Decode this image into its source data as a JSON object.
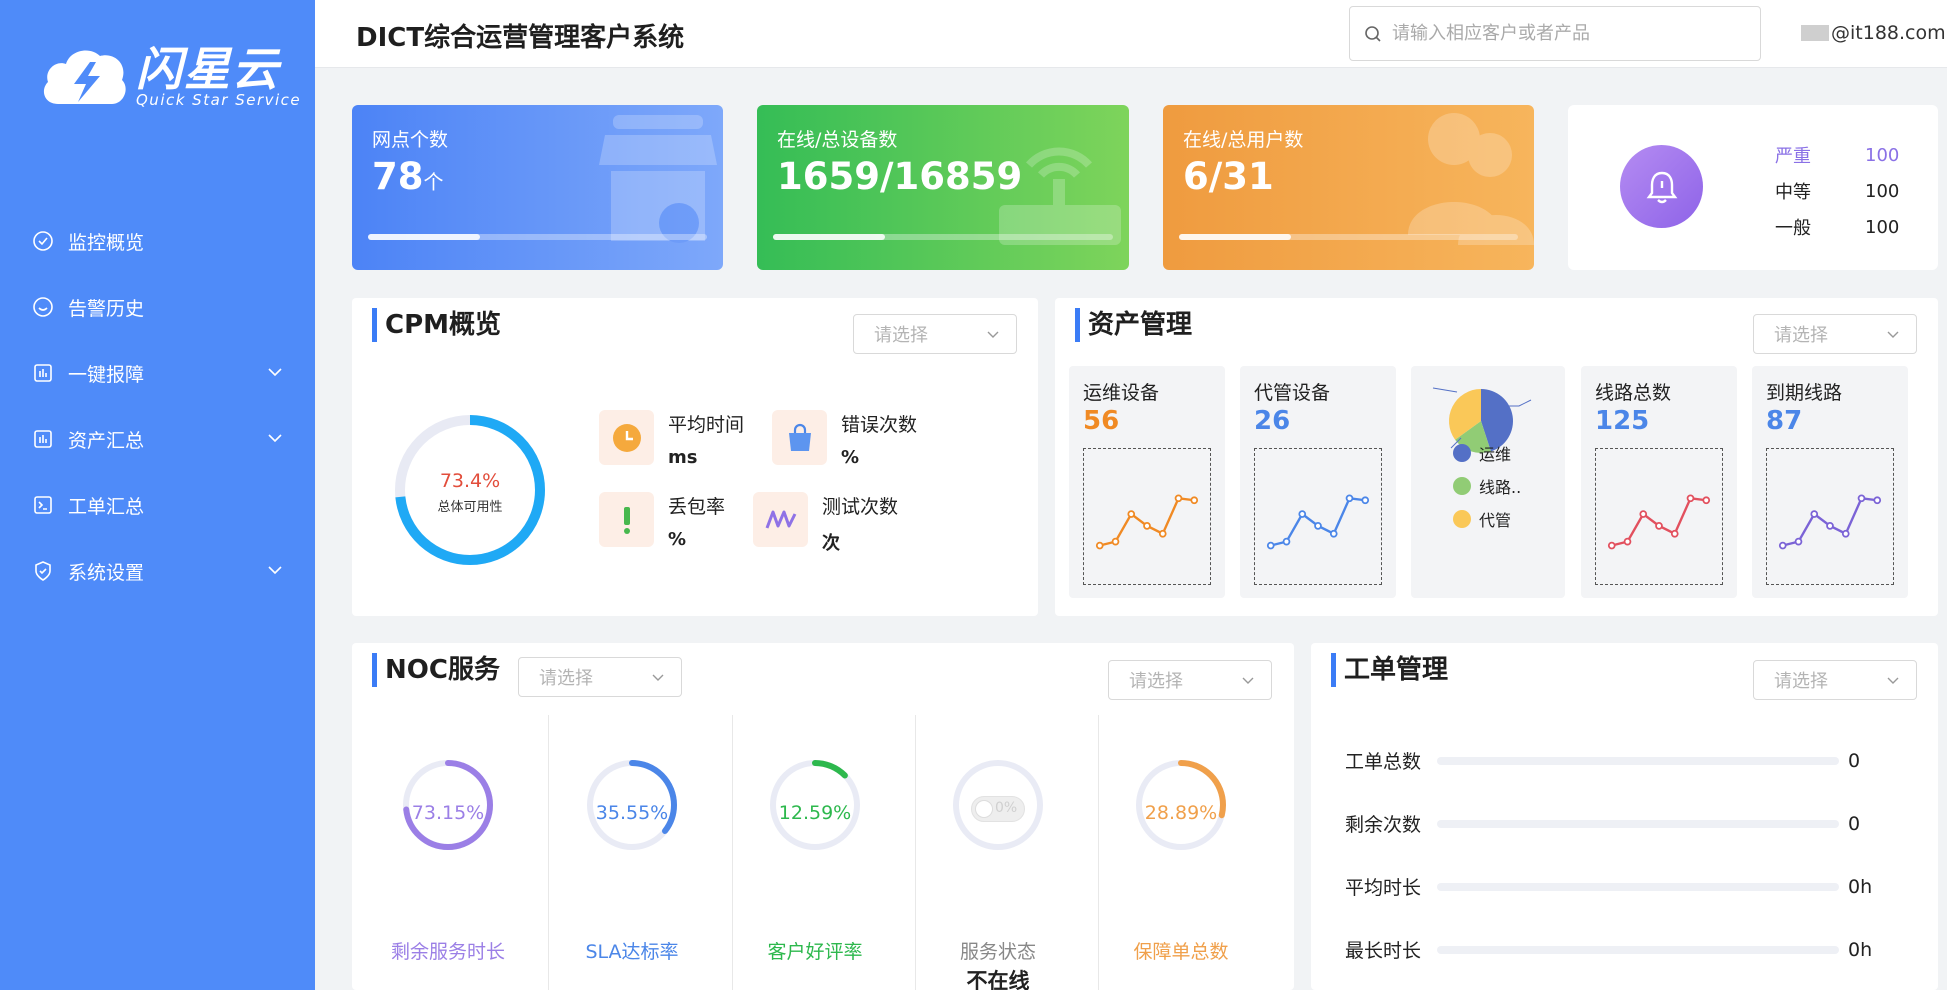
{
  "app": {
    "logo_cn": "闪星云",
    "logo_en": "Quick Star Service",
    "title": "DICT综合运营管理客户系统"
  },
  "header": {
    "search_placeholder": "请输入相应客户或者产品",
    "user_email": "@it188.com"
  },
  "sidebar": {
    "items": [
      {
        "label": "监控概览",
        "icon": "check-circle-icon",
        "has_submenu": false
      },
      {
        "label": "告警历史",
        "icon": "smile-circle-icon",
        "has_submenu": false
      },
      {
        "label": "一键报障",
        "icon": "chart-box-icon",
        "has_submenu": true
      },
      {
        "label": "资产汇总",
        "icon": "chart-box-icon",
        "has_submenu": true
      },
      {
        "label": "工单汇总",
        "icon": "terminal-icon",
        "has_submenu": false
      },
      {
        "label": "系统设置",
        "icon": "shield-check-icon",
        "has_submenu": true
      }
    ]
  },
  "stats": [
    {
      "label": "网点个数",
      "value": "78",
      "unit": "个",
      "progress": 0.33,
      "icon": "store-icon",
      "color": "#4c83f6"
    },
    {
      "label": "在线/总设备数",
      "value": "1659/16859",
      "unit": "",
      "progress": 0.33,
      "icon": "router-icon",
      "color": "#35bd56"
    },
    {
      "label": "在线/总用户数",
      "value": "6/31",
      "unit": "",
      "progress": 0.33,
      "icon": "users-icon",
      "color": "#ef9b3f"
    }
  ],
  "alarms": {
    "icon": "bell-icon",
    "levels": [
      {
        "name": "严重",
        "count": "100",
        "highlight": true
      },
      {
        "name": "中等",
        "count": "100",
        "highlight": false
      },
      {
        "name": "一般",
        "count": "100",
        "highlight": false
      }
    ]
  },
  "cpm": {
    "title": "CPM概览",
    "select_placeholder": "请选择",
    "availability": {
      "percent": "73.4%",
      "fraction": 0.734,
      "label": "总体可用性",
      "color": "#1fa9f5"
    },
    "metrics": [
      {
        "label": "平均时间",
        "unit": "ms",
        "icon": "clock-icon"
      },
      {
        "label": "错误次数",
        "unit": "%",
        "icon": "bag-icon"
      },
      {
        "label": "丢包率",
        "unit": "%",
        "icon": "exclamation-icon"
      },
      {
        "label": "测试次数",
        "unit": "次",
        "icon": "wave-icon"
      }
    ]
  },
  "assets": {
    "title": "资产管理",
    "select_placeholder": "请选择",
    "cards": [
      {
        "name": "运维设备",
        "value": "56",
        "color": "#f08a24",
        "trend": [
          3,
          3.2,
          4.6,
          4,
          3.6,
          5.4,
          5.3
        ]
      },
      {
        "name": "代管设备",
        "value": "26",
        "color": "#4b86e8",
        "trend": [
          3,
          3.2,
          4.6,
          4,
          3.6,
          5.4,
          5.3
        ]
      },
      {
        "name": "线路总数",
        "value": "125",
        "color": "#e2505e",
        "trend": [
          3,
          3.2,
          4.6,
          4,
          3.6,
          5.4,
          5.3
        ]
      },
      {
        "name": "到期线路",
        "value": "87",
        "color": "#7b63d6",
        "trend": [
          3,
          3.2,
          4.6,
          4,
          3.6,
          5.4,
          5.3
        ]
      }
    ],
    "pie": {
      "legend": [
        {
          "name": "运维",
          "color": "#5470c6"
        },
        {
          "name": "线路..",
          "color": "#91cc75"
        },
        {
          "name": "代管",
          "color": "#fac858"
        }
      ],
      "slices": [
        0.45,
        0.2,
        0.35
      ]
    }
  },
  "noc": {
    "title": "NOC服务",
    "select_placeholder_1": "请选择",
    "select_placeholder_2": "请选择",
    "gauges": [
      {
        "label": "剩余服务时长",
        "percent": "73.15%",
        "fraction": 0.7315,
        "color": "#9b7fe6",
        "status": ""
      },
      {
        "label": "SLA达标率",
        "percent": "35.55%",
        "fraction": 0.3555,
        "color": "#4b86e8",
        "status": ""
      },
      {
        "label": "客户好评率",
        "percent": "12.59%",
        "fraction": 0.1259,
        "color": "#2db84d",
        "status": ""
      },
      {
        "label": "服务状态",
        "percent": "",
        "fraction": 0,
        "color": "#999999",
        "status": "不在线",
        "toggle": "0%"
      },
      {
        "label": "保障单总数",
        "percent": "28.89%",
        "fraction": 0.2889,
        "color": "#f0a04b",
        "status": ""
      }
    ]
  },
  "work_orders": {
    "title": "工单管理",
    "select_placeholder": "请选择",
    "rows": [
      {
        "label": "工单总数",
        "value": "0",
        "fraction": 0
      },
      {
        "label": "剩余次数",
        "value": "0",
        "fraction": 0
      },
      {
        "label": "平均时长",
        "value": "0h",
        "fraction": 0
      },
      {
        "label": "最长时长",
        "value": "0h",
        "fraction": 0
      }
    ]
  }
}
